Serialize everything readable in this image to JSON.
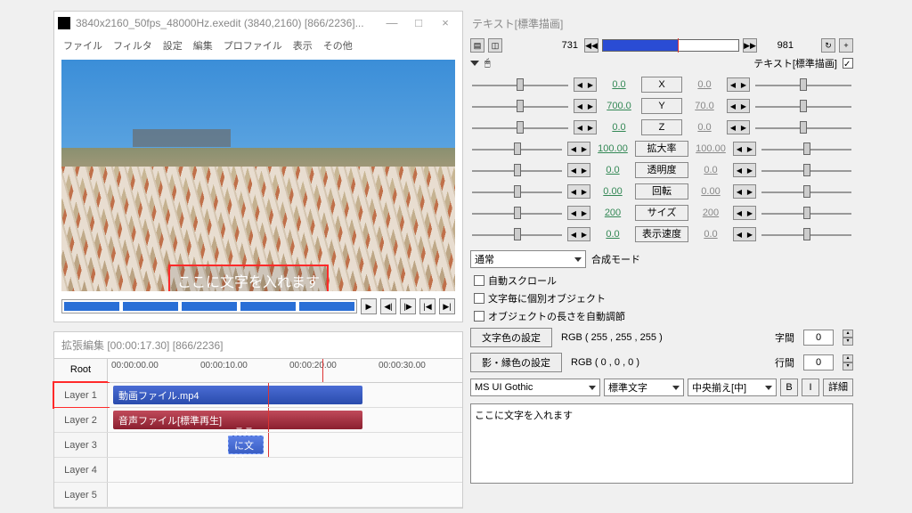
{
  "video_win": {
    "title": "3840x2160_50fps_48000Hz.exedit (3840,2160)  [866/2236]...",
    "menu": [
      "ファイル",
      "フィルタ",
      "設定",
      "編集",
      "プロファイル",
      "表示",
      "その他"
    ],
    "overlay_text": "ここに文字を入れます"
  },
  "timeline": {
    "title": "拡張編集 [00:00:17.30] [866/2236]",
    "root_label": "Root",
    "ticks": [
      "00:00:00.00",
      "00:00:10.00",
      "00:00:20.00",
      "00:00:30.00"
    ],
    "layers": [
      {
        "label": "Layer 1",
        "clip": "動画ファイル.mp4",
        "style": "blue",
        "highlight": true
      },
      {
        "label": "Layer 2",
        "clip": "音声ファイル[標準再生]",
        "style": "red"
      },
      {
        "label": "Layer 3",
        "clip": "ここに文字",
        "style": "text"
      },
      {
        "label": "Layer 4"
      },
      {
        "label": "Layer 5"
      }
    ]
  },
  "prop": {
    "title": "テキスト[標準描画]",
    "frame_start": "731",
    "frame_end": "981",
    "header_label": "テキスト[標準描画]",
    "params": [
      {
        "name": "X",
        "l": "0.0",
        "r": "0.0"
      },
      {
        "name": "Y",
        "l": "700.0",
        "r": "70.0"
      },
      {
        "name": "Z",
        "l": "0.0",
        "r": "0.0"
      },
      {
        "name": "拡大率",
        "l": "100.00",
        "r": "100.00"
      },
      {
        "name": "透明度",
        "l": "0.0",
        "r": "0.0"
      },
      {
        "name": "回転",
        "l": "0.00",
        "r": "0.00"
      },
      {
        "name": "サイズ",
        "l": "200",
        "r": "200"
      },
      {
        "name": "表示速度",
        "l": "0.0",
        "r": "0.0"
      }
    ],
    "blend_label": "合成モード",
    "blend_value": "通常",
    "check_auto_scroll": "自動スクロール",
    "check_per_char": "文字毎に個別オブジェクト",
    "check_auto_len": "オブジェクトの長さを自動調節",
    "text_color_btn": "文字色の設定",
    "text_color_val": "RGB ( 255 , 255 , 255 )",
    "shadow_color_btn": "影・縁色の設定",
    "shadow_color_val": "RGB ( 0 , 0 , 0 )",
    "spacing_label": "字間",
    "spacing_val": "0",
    "line_label": "行間",
    "line_val": "0",
    "font": "MS UI Gothic",
    "weight": "標準文字",
    "align": "中央揃え[中]",
    "bold": "B",
    "italic": "I",
    "detail": "詳細",
    "text_input": "ここに文字を入れます"
  }
}
